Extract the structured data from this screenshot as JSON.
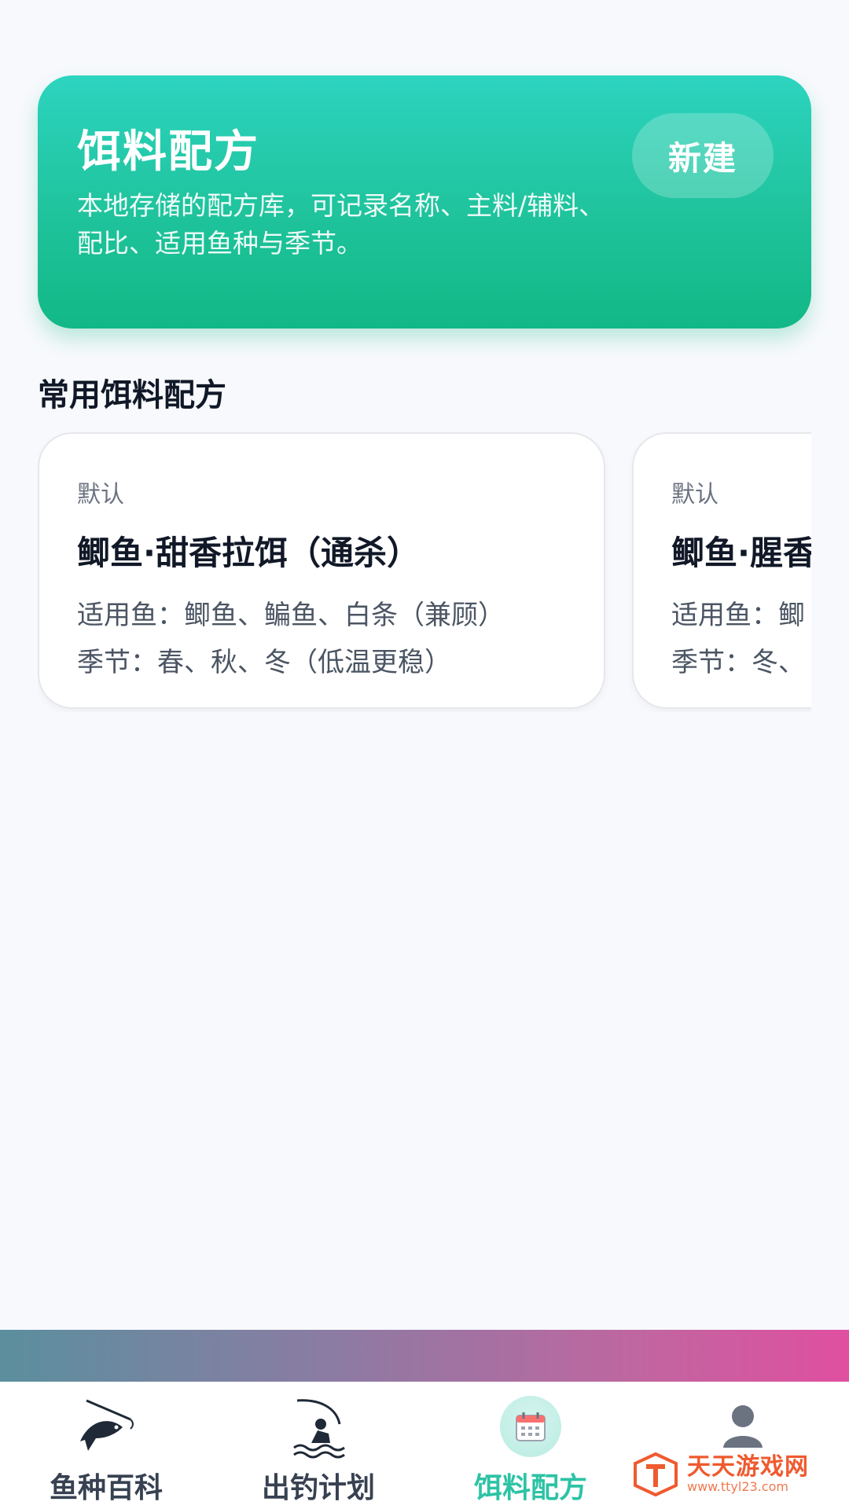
{
  "hero": {
    "title": "饵料配方",
    "description": "本地存储的配方库，可记录名称、主料/辅料、配比、适用鱼种与季节。",
    "new_button": "新建"
  },
  "section": {
    "title": "常用饵料配方"
  },
  "recipes": [
    {
      "tag": "默认",
      "title": "鲫鱼·甜香拉饵（通杀）",
      "fish": "适用鱼：鲫鱼、鳊鱼、白条（兼顾）",
      "season": "季节：春、秋、冬（低温更稳）"
    },
    {
      "tag": "默认",
      "title": "鲫鱼·腥香",
      "fish": "适用鱼：鲫",
      "season": "季节：冬、"
    }
  ],
  "nav": {
    "items": [
      {
        "label": "鱼种百科",
        "icon": "fishing-fish-icon",
        "active": false
      },
      {
        "label": "出钓计划",
        "icon": "angler-icon",
        "active": false
      },
      {
        "label": "饵料配方",
        "icon": "calendar-icon",
        "active": true
      },
      {
        "label": "",
        "icon": "profile-icon",
        "active": false
      }
    ]
  },
  "watermark": {
    "name": "天天游戏网",
    "url": "www.ttyl23.com"
  },
  "colors": {
    "accent": "#2dc3a5",
    "hero_top": "#2dd4bf",
    "hero_bottom": "#12b886"
  }
}
